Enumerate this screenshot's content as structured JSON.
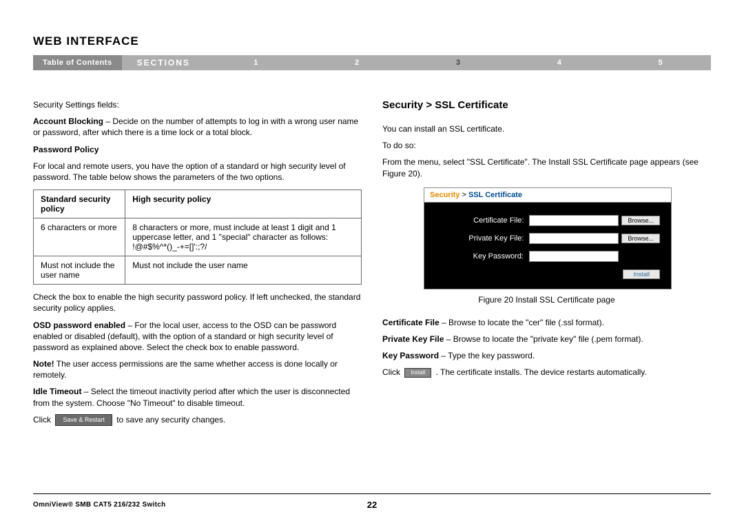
{
  "page_title": "Web Interface",
  "navbar": {
    "toc": "Table of Contents",
    "sections_label": "SECTIONS",
    "sections": [
      "1",
      "2",
      "3",
      "4",
      "5"
    ],
    "active_section": "3"
  },
  "left": {
    "fields_heading": "Security Settings fields:",
    "account_blocking_label": "Account Blocking",
    "account_blocking_text": " – Decide on the number of attempts to log in with a wrong user name or password, after which there is a time lock or a total block.",
    "password_policy_label": "Password Policy",
    "password_policy_text": "For local and remote users, you have the option of a standard or high security level of password. The table below shows the parameters of the two options.",
    "table": {
      "col1_header": "Standard security policy",
      "col2_header": "High security policy",
      "row1_col1": "6 characters or more",
      "row1_col2": "8 characters or more, must include at least 1 digit and 1 uppercase letter, and 1 \"special\" character as follows: !@#$%^*()_-+=[]':;?/",
      "row2_col1": "Must not include the user name",
      "row2_col2": "Must not include the user name"
    },
    "checkbox_text": "Check the box to enable the high security password policy. If left unchecked, the standard security policy applies.",
    "osd_label": "OSD password enabled",
    "osd_text": " – For the local user, access to the OSD can be password enabled or disabled (default), with the option of a standard or high security level of password as explained above. Select the check box to enable password.",
    "note_label": "Note!",
    "note_text": " The user access permissions are the same whether access is done locally or remotely.",
    "idle_label": "Idle Timeout",
    "idle_text": " – Select the timeout inactivity period after which the user is disconnected from the system. Choose \"No Timeout\" to disable timeout.",
    "click_prefix": "Click ",
    "save_btn": "Save & Restart",
    "click_suffix": " to save any security changes."
  },
  "right": {
    "heading": "Security > SSL Certificate",
    "intro1": "You can install an SSL certificate.",
    "intro2": "To do so:",
    "intro3": "From the menu, select \"SSL Certificate\". The Install SSL Certificate page appears (see Figure 20).",
    "panel": {
      "crumb_security": "Security",
      "crumb_sep": " > ",
      "crumb_page": "SSL Certificate",
      "cert_file_label": "Certificate File:",
      "priv_key_label": "Private Key File:",
      "key_pass_label": "Key Password:",
      "browse_btn": "Browse...",
      "install_btn": "Install"
    },
    "fig_caption": "Figure 20 Install SSL Certificate page",
    "cert_file_label": "Certificate File",
    "cert_file_text": " – Browse to locate the \"cer\" file (.ssl format).",
    "priv_key_label": "Private Key File",
    "priv_key_text": " – Browse to locate the \"private key\" file (.pem format).",
    "key_pass_label": "Key Password",
    "key_pass_text": " – Type the key password.",
    "click_prefix": "Click ",
    "install_btn_inline": "Install",
    "click_suffix": " . The certificate installs. The device restarts automatically."
  },
  "footer": {
    "product": "OmniView® SMB CAT5 216/232 Switch",
    "page_number": "22"
  }
}
